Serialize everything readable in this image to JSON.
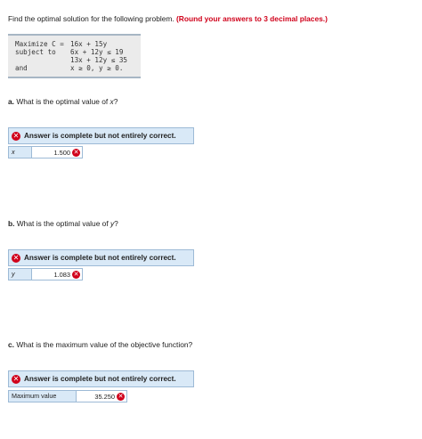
{
  "intro": {
    "text": "Find the optimal solution for the following problem.",
    "emphasis": "(Round your answers to 3 decimal places.)"
  },
  "problem": {
    "maximize_label": "Maximize C =",
    "objective": "16x + 15y",
    "subject_label": "subject to",
    "constraint1": "6x + 12y ≤ 19",
    "constraint2": "13x + 12y ≤ 35",
    "and_label": "and",
    "nonneg": "x ≥ 0, y ≥ 0."
  },
  "questions": [
    {
      "prefix": "a.",
      "text_before": "What is the optimal value of ",
      "var": "x",
      "text_after": "?",
      "banner": "Answer is complete but not entirely correct.",
      "label": "x",
      "value": "1.500"
    },
    {
      "prefix": "b.",
      "text_before": "What is the optimal value of ",
      "var": "y",
      "text_after": "?",
      "banner": "Answer is complete but not entirely correct.",
      "label": "y",
      "value": "1.083"
    },
    {
      "prefix": "c.",
      "text_before": "What is the maximum value of the objective function?",
      "var": "",
      "text_after": "",
      "banner": "Answer is complete but not entirely correct.",
      "label": "Maximum value",
      "value": "35.250"
    }
  ],
  "icons": {
    "incorrect": "x-circle-icon"
  },
  "colors": {
    "error_red": "#d0021b",
    "banner_bg": "#d9e9f7",
    "banner_border": "#9dbad6"
  }
}
